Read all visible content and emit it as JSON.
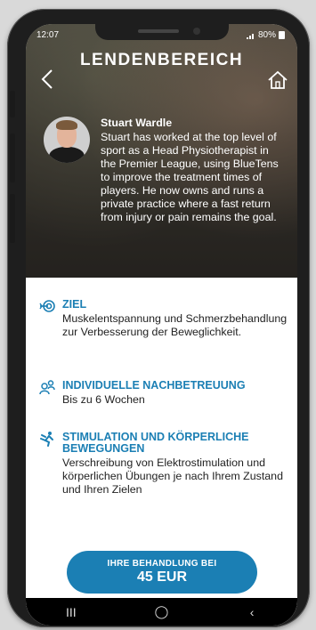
{
  "status": {
    "time": "12:07",
    "battery": "80%"
  },
  "header": {
    "title": "LENDENBEREICH"
  },
  "therapist": {
    "name": "Stuart Wardle",
    "bio": "Stuart has worked at the top level of sport as a Head Physiotherapist in the Premier League, using BlueTens to improve the treatment times of players. He now owns and runs a private practice where a fast return from injury or pain remains the goal."
  },
  "items": [
    {
      "icon": "target-icon",
      "title": "ZIEL",
      "desc": "Muskelentspannung und Schmerzbehandlung zur Verbesserung der Beweglichkeit."
    },
    {
      "icon": "people-icon",
      "title": "INDIVIDUELLE NACHBETREUUNG",
      "desc": "Bis zu 6 Wochen"
    },
    {
      "icon": "runner-icon",
      "title": "STIMULATION UND KÖRPERLICHE BEWEGUNGEN",
      "desc": "Verschreibung von Elektrostimulation und körperlichen Übungen je nach Ihrem Zustand und Ihren Zielen"
    }
  ],
  "cta": {
    "label": "IHRE BEHANDLUNG BEI",
    "price": "45 EUR"
  },
  "navbar": {
    "recents": "III",
    "home": "◯",
    "back": "‹"
  },
  "colors": {
    "accent": "#1b7fb4"
  }
}
